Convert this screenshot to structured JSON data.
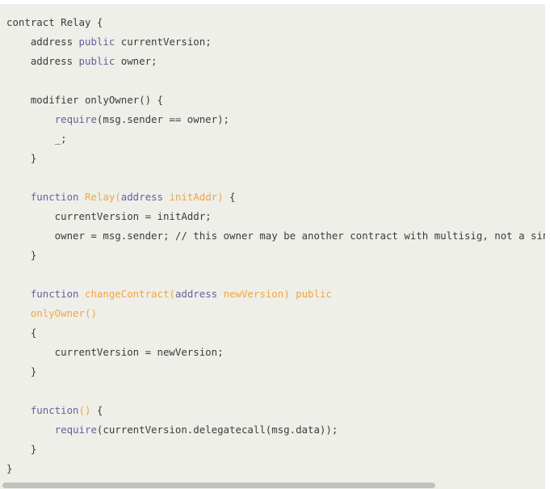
{
  "code": {
    "lines": [
      [
        {
          "t": "contract Relay {",
          "c": "plain"
        }
      ],
      [
        {
          "t": "    address ",
          "c": "plain"
        },
        {
          "t": "public",
          "c": "kw"
        },
        {
          "t": " currentVersion;",
          "c": "plain"
        }
      ],
      [
        {
          "t": "    address ",
          "c": "plain"
        },
        {
          "t": "public",
          "c": "kw"
        },
        {
          "t": " owner;",
          "c": "plain"
        }
      ],
      [],
      [
        {
          "t": "    modifier onlyOwner() {",
          "c": "plain"
        }
      ],
      [
        {
          "t": "        ",
          "c": "plain"
        },
        {
          "t": "require",
          "c": "kw"
        },
        {
          "t": "(msg.sender == owner);",
          "c": "plain"
        }
      ],
      [
        {
          "t": "        _;",
          "c": "plain"
        }
      ],
      [
        {
          "t": "    }",
          "c": "plain"
        }
      ],
      [],
      [
        {
          "t": "    ",
          "c": "plain"
        },
        {
          "t": "function",
          "c": "kw"
        },
        {
          "t": " ",
          "c": "plain"
        },
        {
          "t": "Relay(",
          "c": "fn"
        },
        {
          "t": "address",
          "c": "kw"
        },
        {
          "t": " ",
          "c": "plain"
        },
        {
          "t": "initAddr)",
          "c": "fn"
        },
        {
          "t": " {",
          "c": "plain"
        }
      ],
      [
        {
          "t": "        currentVersion = initAddr;",
          "c": "plain"
        }
      ],
      [
        {
          "t": "        owner = msg.sender; // this owner may be another contract with multisig, not a single contract owner",
          "c": "plain"
        }
      ],
      [
        {
          "t": "    }",
          "c": "plain"
        }
      ],
      [],
      [
        {
          "t": "    ",
          "c": "plain"
        },
        {
          "t": "function",
          "c": "kw"
        },
        {
          "t": " ",
          "c": "plain"
        },
        {
          "t": "changeContract(",
          "c": "fn"
        },
        {
          "t": "address",
          "c": "kw"
        },
        {
          "t": " ",
          "c": "plain"
        },
        {
          "t": "newVersion) public",
          "c": "fn"
        }
      ],
      [
        {
          "t": "    ",
          "c": "plain"
        },
        {
          "t": "onlyOwner()",
          "c": "fn"
        }
      ],
      [
        {
          "t": "    {",
          "c": "plain"
        }
      ],
      [
        {
          "t": "        currentVersion = newVersion;",
          "c": "plain"
        }
      ],
      [
        {
          "t": "    }",
          "c": "plain"
        }
      ],
      [],
      [
        {
          "t": "    ",
          "c": "plain"
        },
        {
          "t": "function",
          "c": "kw"
        },
        {
          "t": "() ",
          "c": "fn"
        },
        {
          "t": "{",
          "c": "plain"
        }
      ],
      [
        {
          "t": "        ",
          "c": "plain"
        },
        {
          "t": "require",
          "c": "kw"
        },
        {
          "t": "(currentVersion.delegatecall(msg.data));",
          "c": "plain"
        }
      ],
      [
        {
          "t": "    }",
          "c": "plain"
        }
      ],
      [
        {
          "t": "}",
          "c": "plain"
        }
      ]
    ]
  },
  "colors": {
    "background": "#efefe9",
    "text": "#3b3b3b",
    "keyword": "#6c5b9e",
    "function": "#f0a540",
    "scroll_thumb": "#c1c1bd"
  }
}
